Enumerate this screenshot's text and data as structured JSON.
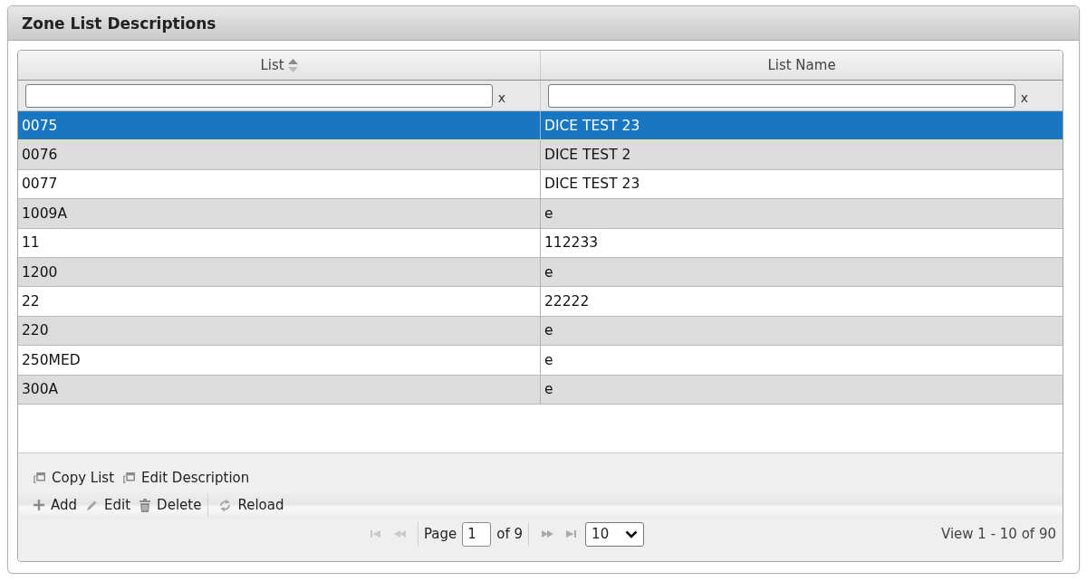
{
  "panel": {
    "title": "Zone List Descriptions"
  },
  "grid": {
    "columns": [
      {
        "label": "List",
        "sortable": true,
        "filter": {
          "clear_label": "x"
        }
      },
      {
        "label": "List Name",
        "sortable": false,
        "filter": {
          "clear_label": "x"
        }
      }
    ],
    "rows": [
      {
        "cells": [
          "0075",
          "DICE TEST 23"
        ],
        "selected": true
      },
      {
        "cells": [
          "0076",
          "DICE TEST 2"
        ],
        "selected": false
      },
      {
        "cells": [
          "0077",
          "DICE TEST 23"
        ],
        "selected": false
      },
      {
        "cells": [
          "1009A",
          "e"
        ],
        "selected": false
      },
      {
        "cells": [
          "11",
          "112233"
        ],
        "selected": false
      },
      {
        "cells": [
          "1200",
          "e"
        ],
        "selected": false
      },
      {
        "cells": [
          "22",
          "22222"
        ],
        "selected": false
      },
      {
        "cells": [
          "220",
          "e"
        ],
        "selected": false
      },
      {
        "cells": [
          "250MED",
          "e"
        ],
        "selected": false
      },
      {
        "cells": [
          "300A",
          "e"
        ],
        "selected": false
      }
    ]
  },
  "toolbars": [
    {
      "items": [
        {
          "kind": "copy",
          "label": "Copy List"
        },
        {
          "kind": "copy",
          "label": "Edit Description"
        }
      ]
    },
    {
      "items": [
        {
          "kind": "add",
          "label": "Add"
        },
        {
          "kind": "edit",
          "label": "Edit"
        },
        {
          "kind": "delete",
          "label": "Delete"
        },
        {
          "kind": "separator"
        },
        {
          "kind": "reload",
          "label": "Reload"
        }
      ]
    }
  ],
  "pager": {
    "buttons_before": [
      {
        "kind": "first",
        "disabled": true
      },
      {
        "kind": "prev",
        "disabled": true
      }
    ],
    "page_label": "Page",
    "page_value": "1",
    "page_count": "of 9",
    "buttons_after": [
      {
        "kind": "next",
        "disabled": false
      },
      {
        "kind": "last",
        "disabled": false
      }
    ],
    "page_size": "10",
    "summary": "View 1 - 10 of 90"
  }
}
